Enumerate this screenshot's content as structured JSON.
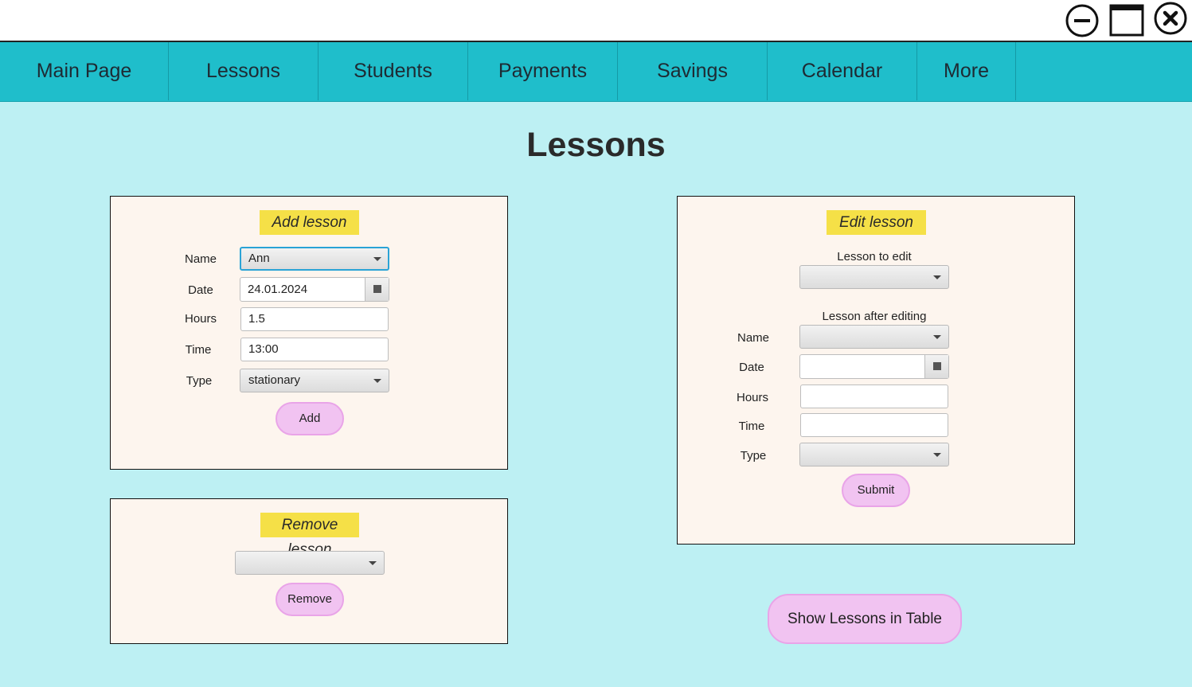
{
  "window": {
    "minimize_icon": "minimize-circle-icon",
    "maximize_icon": "window-maximize-icon",
    "close_icon": "close-circle-icon"
  },
  "nav": {
    "items": [
      {
        "label": "Main Page"
      },
      {
        "label": "Lessons"
      },
      {
        "label": "Students"
      },
      {
        "label": "Payments"
      },
      {
        "label": "Savings"
      },
      {
        "label": "Calendar"
      },
      {
        "label": "More"
      }
    ]
  },
  "page": {
    "title": "Lessons"
  },
  "add_lesson": {
    "title": "Add lesson",
    "name_label": "Name",
    "name_value": "Ann",
    "date_label": "Date",
    "date_value": "24.01.2024",
    "hours_label": "Hours",
    "hours_value": "1.5",
    "time_label": "Time",
    "time_value": "13:00",
    "type_label": "Type",
    "type_value": "stationary",
    "add_button": "Add"
  },
  "remove_lesson": {
    "title": "Remove lesson",
    "select_value": "",
    "remove_button": "Remove"
  },
  "edit_lesson": {
    "title": "Edit lesson",
    "lesson_to_edit_label": "Lesson to edit",
    "lesson_after_label": "Lesson after editing",
    "name_label": "Name",
    "date_label": "Date",
    "hours_label": "Hours",
    "time_label": "Time",
    "type_label": "Type",
    "submit_button": "Submit"
  },
  "show_table_button": "Show Lessons in Table",
  "colors": {
    "background": "#bdf0f3",
    "navbar": "#1fbecb",
    "panel": "#fdf5ee",
    "panel_title": "#f5e047",
    "button": "#f1c3f1"
  }
}
